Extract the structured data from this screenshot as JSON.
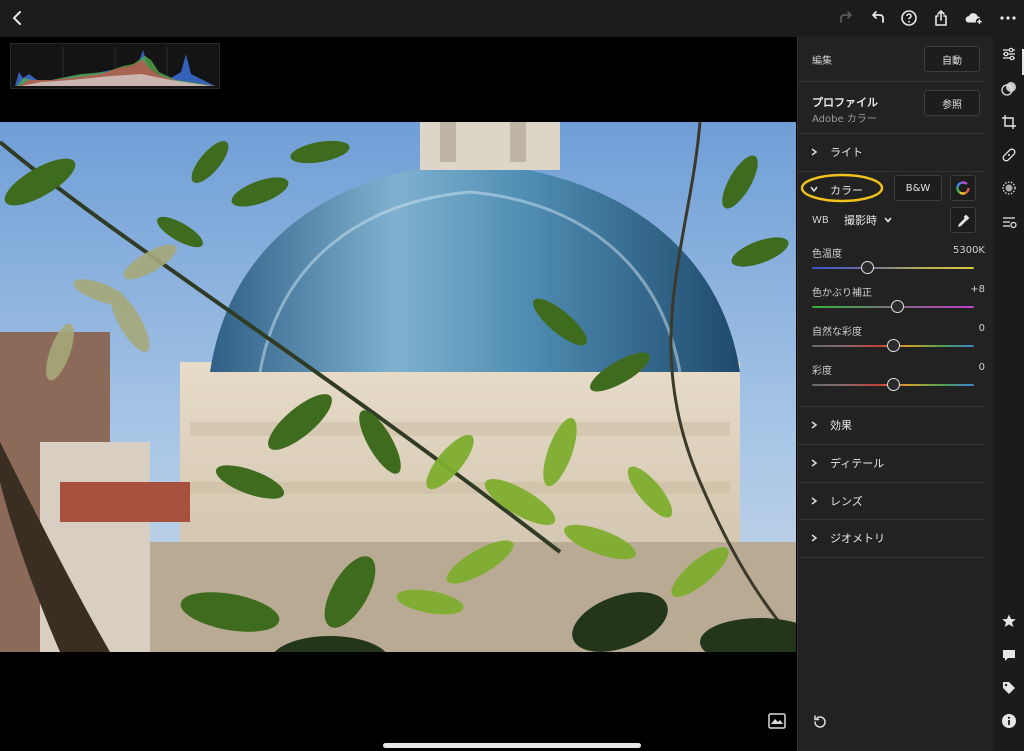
{
  "topbar": {
    "icons": [
      "back-icon",
      "redo-icon",
      "undo-icon",
      "help-icon",
      "share-icon",
      "cloud-icon",
      "more-icon"
    ]
  },
  "panel": {
    "edit_label": "編集",
    "auto_button": "自動",
    "profile_label": "プロファイル",
    "profile_value": "Adobe カラー",
    "browse_button": "参照",
    "light_section": "ライト",
    "color_section": "カラー",
    "bw_button": "B&W",
    "wb_label": "WB",
    "wb_value": "撮影時",
    "sliders": [
      {
        "label": "色温度",
        "value": "5300K",
        "position": 0.34
      },
      {
        "label": "色かぶり補正",
        "value": "+8",
        "position": 0.53
      },
      {
        "label": "自然な彩度",
        "value": "0",
        "position": 0.5
      },
      {
        "label": "彩度",
        "value": "0",
        "position": 0.5
      }
    ],
    "effects_section": "効果",
    "detail_section": "ディテール",
    "lens_section": "レンズ",
    "geometry_section": "ジオメトリ",
    "highlight_color": "#f2c21b"
  },
  "strip": {
    "icons": [
      "edit-sliders-icon",
      "presets-icon",
      "crop-icon",
      "heal-icon",
      "selective-icon",
      "versions-icon",
      "rating-icon",
      "comment-icon",
      "tag-icon",
      "info-icon"
    ]
  }
}
